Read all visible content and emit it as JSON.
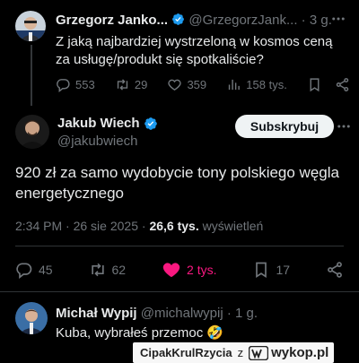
{
  "quoted_tweet": {
    "author_name": "Grzegorz Janko...",
    "handle": "@GrzegorzJank...",
    "separator": "·",
    "time": "3 g.",
    "text": "Z jaką najbardziej wystrzeloną w kosmos ceną za usługę/produkt się spotkaliście?",
    "stats": {
      "replies": "553",
      "reposts": "29",
      "likes": "359",
      "views": "158 tys."
    }
  },
  "main_tweet": {
    "author_name": "Jakub Wiech",
    "handle": "@jakubwiech",
    "subscribe_label": "Subskrybuj",
    "text": "920 zł za samo wydobycie tony polskiego węgla energetycznego",
    "meta": {
      "time": "2:34 PM",
      "dot": "·",
      "date": "26 sie 2025",
      "dot2": "·",
      "views_count": "26,6 tys.",
      "views_label": "wyświetleń"
    },
    "stats": {
      "replies": "45",
      "reposts": "62",
      "likes": "2 tys.",
      "bookmarks": "17"
    }
  },
  "reply": {
    "author_name": "Michał Wypij",
    "handle": "@michalwypij",
    "separator": "·",
    "time": "1 g.",
    "text": "Kuba, wybrałeś przemoc 🤣"
  },
  "watermark": {
    "user": "CipakKrulRzycia",
    "z": "z",
    "site": "wykop.pl"
  },
  "colors": {
    "background": "#000000",
    "text": "#e7e9ea",
    "muted": "#71767b",
    "verified": "#1d9bf0",
    "like_pink": "#f91880",
    "subscribe_bg": "#eff3f4"
  },
  "icons": [
    "more-icon",
    "reply-icon",
    "repost-icon",
    "like-icon",
    "views-icon",
    "bookmark-icon",
    "share-icon",
    "verified-icon"
  ]
}
